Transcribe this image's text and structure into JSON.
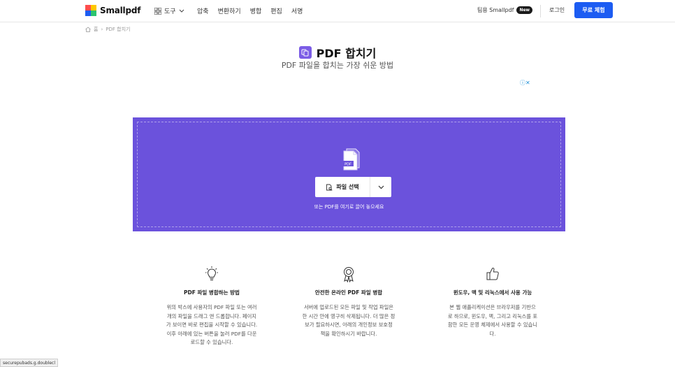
{
  "nav": {
    "brand": "Smallpdf",
    "tools_label": "도구",
    "links": [
      "압축",
      "변환하기",
      "병합",
      "편집",
      "서명"
    ],
    "promo_text": "팀용 Smallpdf",
    "promo_badge": "New",
    "login_label": "로그인",
    "trial_label": "무료 체험"
  },
  "breadcrumb": {
    "home": "홈",
    "separator": "›",
    "current": "PDF 합치기"
  },
  "page": {
    "title": "PDF 합치기",
    "subtitle": "PDF 파일을 합치는 가장 쉬운 방법"
  },
  "ad_choices": "ⓘ✕",
  "dropzone": {
    "doc_label": "PDF",
    "choose_label": "파일 선택",
    "hint": "또는 PDF를 여기로 끌어 놓으세요"
  },
  "features": [
    {
      "title": "PDF 파일 병합하는 방법",
      "lines": [
        "위의 박스에 사용자의 PDF 파일 또는 여러",
        "개의 파일을 드래그 앤 드롭합니다. 페이지",
        "가 보이면 바로 편집을 시작할 수 있습니다.",
        "이후 아래에 있는 버튼을 눌러 PDF를 다운",
        "로드할 수 있습니다."
      ]
    },
    {
      "title": "안전한 온라인 PDF 파일 병합",
      "lines": [
        "서버에 업로드된 모든 파일 및 작업 파일은",
        "한 시간 안에 영구히 삭제됩니다. 더 많은 정",
        "보가 필요하시면, 아래의 개인정보 보호정",
        "책을 확인하시기 바랍니다."
      ]
    },
    {
      "title": "윈도우, 맥 및 리눅스에서 사용 가능",
      "lines": [
        "본 웹 애플리케이션은 브라우저를 기반으",
        "로 하므로, 윈도우, 맥, 그리고 리눅스를 포",
        "함한 모든 운영 체제에서 사용할 수 있습니",
        "다."
      ]
    }
  ],
  "status_text": "securepubads.g.doublecl",
  "colors": {
    "dropzone": "#6b52dc",
    "trial_button": "#1c5cf2",
    "title_icon": "#7b5ce6"
  }
}
